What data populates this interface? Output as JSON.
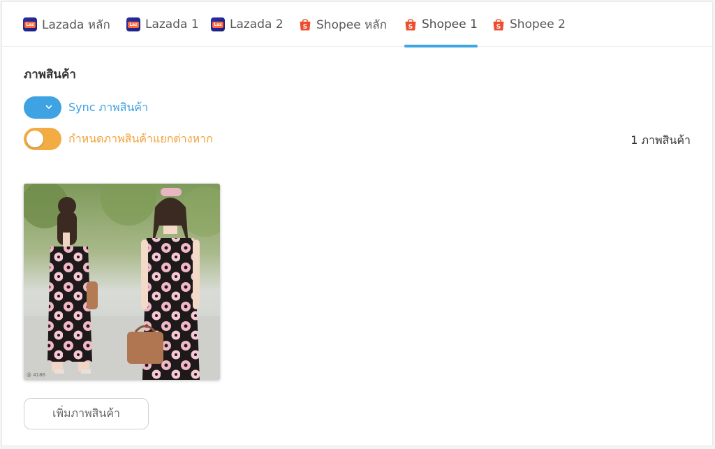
{
  "tabs": [
    {
      "label": "Lazada หลัก",
      "icon": "lazada-icon",
      "active": false
    },
    {
      "label": "Lazada 1",
      "icon": "lazada-icon",
      "active": false
    },
    {
      "label": "Lazada 2",
      "icon": "lazada-icon",
      "active": false
    },
    {
      "label": "Shopee หลัก",
      "icon": "shopee-icon",
      "active": false
    },
    {
      "label": "Shopee 1",
      "icon": "shopee-icon",
      "active": true
    },
    {
      "label": "Shopee 2",
      "icon": "shopee-icon",
      "active": false
    }
  ],
  "section": {
    "title": "ภาพสินค้า",
    "sync_toggle": {
      "label": "Sync ภาพสินค้า",
      "on": true,
      "color": "#3ea2e3"
    },
    "custom_toggle": {
      "label": "กำหนดภาพสินค้าแยกต่างหาก",
      "on": false,
      "color": "#f3ac43"
    },
    "count_label": "1 ภาพสินค้า"
  },
  "image": {
    "icon": "product-photo",
    "watermark": "@ 4186"
  },
  "add_button": {
    "label": "เพิ่มภาพสินค้า"
  },
  "colors": {
    "accent": "#3ea6e6",
    "toggle_on": "#3ea2e3",
    "toggle_off": "#f3ac43",
    "lazada": "#1a1e7a",
    "shopee": "#ee4d2d"
  }
}
